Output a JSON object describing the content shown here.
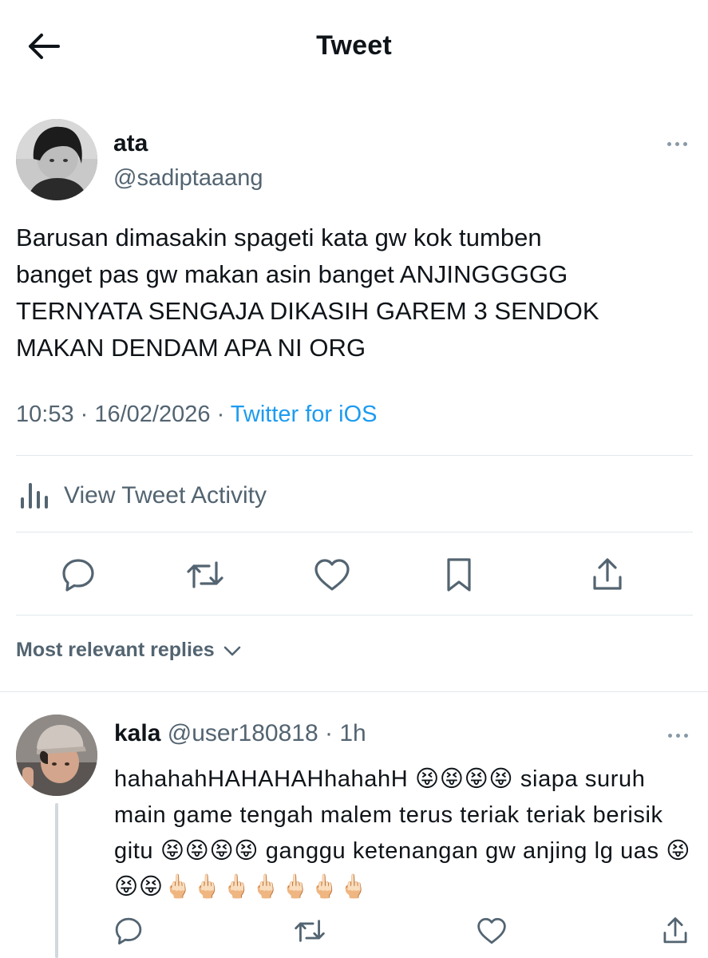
{
  "header": {
    "title": "Tweet",
    "back_icon": "arrow-left-icon"
  },
  "tweet": {
    "name": "ata",
    "handle": "@sadiptaaang",
    "text": "Barusan dimasakin spageti kata gw kok tumben\nbanget pas gw makan asin banget ANJINGGGGG\nTERNYATA SENGAJA DIKASIH GAREM 3 SENDOK\nMAKAN DENDAM APA NI ORG",
    "time": "10:53",
    "date": "16/02/2026",
    "separator": " · ",
    "source": "Twitter for iOS",
    "activity_label": "View Tweet Activity"
  },
  "actions": [
    "reply-icon",
    "retweet-icon",
    "like-icon",
    "bookmark-icon",
    "share-icon"
  ],
  "replies": {
    "sort_label": "Most relevant replies",
    "items": [
      {
        "name": "kala",
        "handle": "@user180818",
        "separator": " · ",
        "time": "1h",
        "text": "hahahahHAHAHAHhahahH 😝😝😝😝 siapa suruh main game tengah malem terus teriak teriak berisik gitu 😝😝😝😝 ganggu ketenangan gw anjing lg uas 😝😝😝🖕🏻🖕🏻🖕🏻🖕🏻🖕🏻🖕🏻🖕🏻"
      }
    ]
  },
  "colors": {
    "text": "#0f1419",
    "secondary": "#536471",
    "link": "#1d9bf0",
    "divider": "#e1e8ed"
  }
}
